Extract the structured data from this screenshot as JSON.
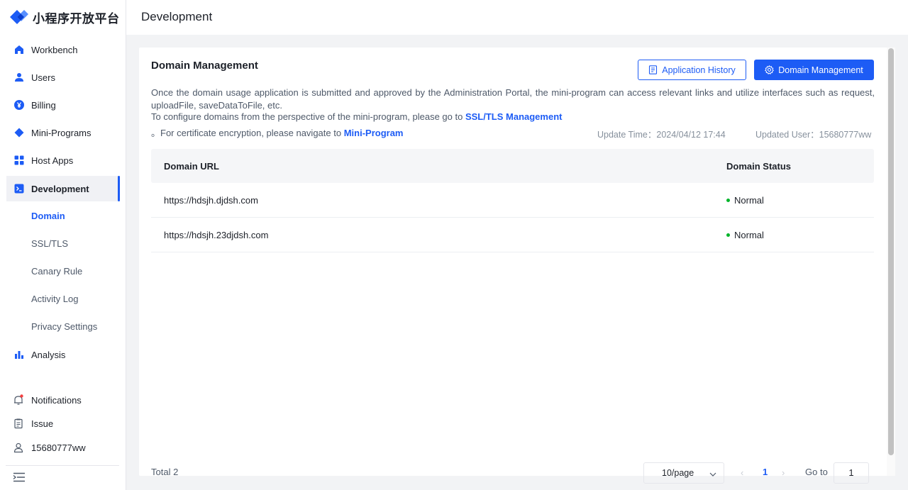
{
  "brand": {
    "name": "小程序开放平台"
  },
  "sidebar": {
    "items": [
      {
        "label": "Workbench",
        "icon": "home-icon"
      },
      {
        "label": "Users",
        "icon": "user-icon"
      },
      {
        "label": "Billing",
        "icon": "yen-icon"
      },
      {
        "label": "Mini-Programs",
        "icon": "diamond-icon"
      },
      {
        "label": "Host Apps",
        "icon": "grid-icon"
      },
      {
        "label": "Development",
        "icon": "terminal-icon",
        "active": true
      },
      {
        "label": "Analysis",
        "icon": "bar-chart-icon"
      }
    ],
    "sub_items": [
      {
        "label": "Domain",
        "active": true
      },
      {
        "label": "SSL/TLS"
      },
      {
        "label": "Canary Rule"
      },
      {
        "label": "Activity Log"
      },
      {
        "label": "Privacy Settings"
      }
    ],
    "bottom": {
      "notifications": "Notifications",
      "issue": "Issue",
      "user": "15680777ww"
    }
  },
  "header": {
    "title": "Development"
  },
  "main": {
    "title": "Domain Management",
    "buttons": {
      "history": "Application History",
      "manage": "Domain Management"
    },
    "description": "Once the domain usage application is submitted and approved by the Administration Portal, the mini-program can access relevant links and utilize interfaces such as request, uploadFile, saveDataToFile, etc.",
    "line2_prefix": "To configure domains from the perspective of the mini-program, please go to ",
    "line2_link": "SSL/TLS Management",
    "line3_prefix": "。For certificate encryption, please navigate to ",
    "line3_link": "Mini-Program",
    "update_time": "Update Time：2024/04/12 17:44",
    "updated_user": "Updated User：15680777ww",
    "table": {
      "headers": {
        "url": "Domain URL",
        "status": "Domain Status"
      },
      "rows": [
        {
          "url": "https://hdsjh.djdsh.com",
          "status": "Normal"
        },
        {
          "url": "https://hdsjh.23djdsh.com",
          "status": "Normal"
        }
      ]
    },
    "pagination": {
      "total": "Total 2",
      "page_size": "10/page",
      "prev": "‹",
      "current": "1",
      "next": "›",
      "goto_label": "Go to",
      "goto_value": "1"
    }
  },
  "colors": {
    "accent": "#1d5cf5",
    "status_ok": "#00b42a"
  }
}
